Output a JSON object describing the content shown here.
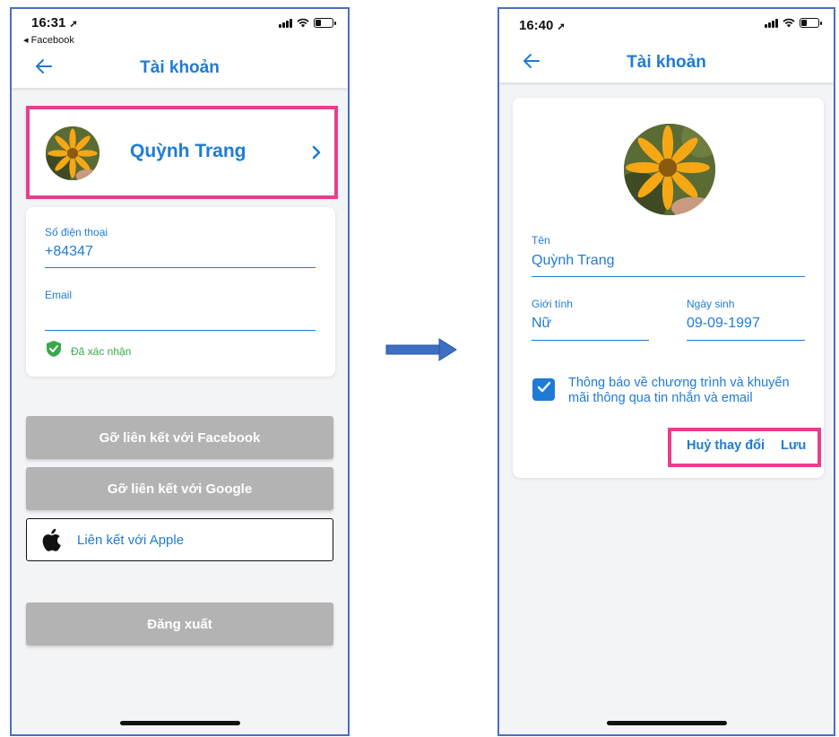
{
  "left_screen": {
    "status": {
      "time": "16:31",
      "back_app": "◂ Facebook"
    },
    "nav": {
      "title": "Tài khoản"
    },
    "profile": {
      "name": "Quỳnh Trang"
    },
    "phone": {
      "label": "Số điện thoại",
      "value": "+84347"
    },
    "email": {
      "label": "Email",
      "value": ""
    },
    "verified": {
      "text": "Đã xác nhận"
    },
    "buttons": {
      "unlink_facebook": "Gỡ liên kết với Facebook",
      "unlink_google": "Gỡ liên kết với Google",
      "link_apple": "Liên kết với Apple",
      "logout": "Đăng xuất"
    }
  },
  "right_screen": {
    "status": {
      "time": "16:40"
    },
    "nav": {
      "title": "Tài khoản"
    },
    "name_field": {
      "label": "Tên",
      "value": "Quỳnh Trang"
    },
    "gender_field": {
      "label": "Giới tính",
      "value": "Nữ"
    },
    "birthday_field": {
      "label": "Ngày sinh",
      "value": "09-09-1997"
    },
    "consent": {
      "checked": true,
      "text": "Thông báo về chương trình và khuyến mãi thông qua tin nhắn và email"
    },
    "actions": {
      "cancel": "Huỷ thay đổi",
      "save": "Lưu"
    }
  },
  "colors": {
    "accent": "#1e7bd6",
    "highlight": "#e83e8c",
    "disabled_button": "#b3b3b3",
    "verified": "#3aa84a",
    "frame": "#4a6fc2"
  },
  "icons": [
    "back-arrow-icon",
    "chevron-right-icon",
    "shield-check-icon",
    "apple-icon",
    "checkbox-check-icon",
    "signal-icon",
    "wifi-icon",
    "battery-icon",
    "location-arrow-icon",
    "transition-arrow-icon"
  ]
}
